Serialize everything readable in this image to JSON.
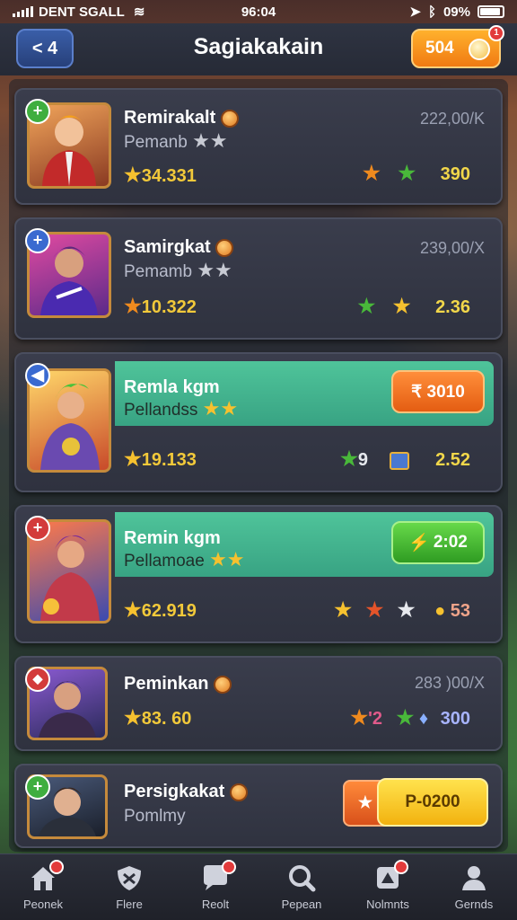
{
  "status_bar": {
    "carrier": "DENT SGALL",
    "time": "96:04",
    "battery": "09%"
  },
  "header": {
    "back_label": "< 4",
    "title": "Sagiakakain",
    "coins": "504",
    "coin_badge": "1"
  },
  "cards": [
    {
      "name": "Remirakalt",
      "subtitle": "Pemanb",
      "rating": "34.331",
      "price": "222,00/K",
      "stat": "390",
      "badge": "+"
    },
    {
      "name": "Samirgkat",
      "subtitle": "Pemamb",
      "rating": "10.322",
      "price": "239,00/X",
      "stat": "2.36",
      "badge": "+"
    },
    {
      "name": "Remla kgm",
      "subtitle": "Pellandss",
      "rating": "19.133",
      "action": "₹ 3010",
      "extra": "9",
      "stat": "2.52",
      "badge": "◀"
    },
    {
      "name": "Remin kgm",
      "subtitle": "Pellamoae",
      "rating": "62.919",
      "action": "2:02",
      "stat": "53",
      "badge": "+"
    },
    {
      "name": "Peminkan",
      "subtitle": "",
      "rating": "83. 60",
      "price": "283 )00/X",
      "extra": "'2",
      "stat": "300",
      "badge": "◆"
    },
    {
      "name": "Persigkakat",
      "subtitle": "Pomlmy",
      "action": "P-0200",
      "badge": "+"
    }
  ],
  "bottom_nav": [
    {
      "label": "Peonek",
      "icon": "home-icon"
    },
    {
      "label": "Flere",
      "icon": "shield-icon"
    },
    {
      "label": "Reolt",
      "icon": "chat-icon"
    },
    {
      "label": "Pepean",
      "icon": "search-icon"
    },
    {
      "label": "Nolmnts",
      "icon": "trophy-icon"
    },
    {
      "label": "Gernds",
      "icon": "profile-icon"
    }
  ]
}
